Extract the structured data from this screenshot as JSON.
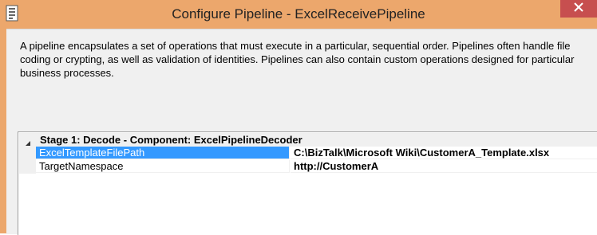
{
  "window": {
    "title": "Configure Pipeline - ExcelReceivePipeline",
    "icon": "pipeline-app-icon",
    "close_icon": "close-icon",
    "accent_color": "#eca76c",
    "close_color": "#c74f4f"
  },
  "description": "A pipeline encapsulates a set of operations that must execute in a particular, sequential order. Pipelines often handle file coding or crypting, as well as validation of identities. Pipelines can also contain custom operations designed for particular business processes.",
  "property_grid": {
    "category": {
      "label": "Stage 1: Decode - Component: ExcelPipelineDecoder",
      "expanded": true,
      "expand_icon": "collapse-triangle-icon"
    },
    "properties": [
      {
        "name": "ExcelTemplateFilePath",
        "value": "C:\\BizTalk\\Microsoft Wiki\\CustomerA_Template.xlsx",
        "selected": true
      },
      {
        "name": "TargetNamespace",
        "value": "http://CustomerA",
        "selected": false
      }
    ],
    "selection_color": "#3399ff"
  }
}
